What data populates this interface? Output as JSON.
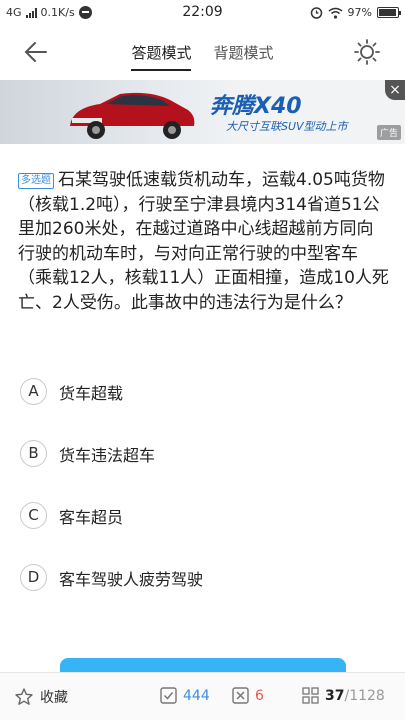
{
  "status_bar": {
    "network": "4G",
    "speed": "0.1K/s",
    "time": "22:09",
    "battery": "97%",
    "battery_level": 0.97
  },
  "nav": {
    "tabs": [
      {
        "label": "答题模式",
        "active": true
      },
      {
        "label": "背题模式",
        "active": false
      }
    ],
    "icons": {
      "back": "back-arrow-icon",
      "theme": "brightness-icon"
    }
  },
  "ad": {
    "brand": "奔腾X40",
    "slogan": "大尺寸互联SUV型动上市",
    "tag": "广告",
    "close": "×"
  },
  "question": {
    "type_badge": "多选题",
    "text": "石某驾驶低速载货机动车，运载4.05吨货物（核载1.2吨），行驶至宁津县境内314省道51公里加260米处，在越过道路中心线超越前方同向行驶的机动车时，与对向正常行驶的中型客车（乘载12人，核载11人）正面相撞，造成10人死亡、2人受伤。此事故中的违法行为是什么？"
  },
  "options": [
    {
      "letter": "A",
      "text": "货车超载"
    },
    {
      "letter": "B",
      "text": "货车违法超车"
    },
    {
      "letter": "C",
      "text": "客车超员"
    },
    {
      "letter": "D",
      "text": "客车驾驶人疲劳驾驶"
    }
  ],
  "bottom_bar": {
    "favorite_label": "收藏",
    "correct_count": "444",
    "wrong_count": "6",
    "current": "37",
    "total": "/1128"
  },
  "colors": {
    "accent": "#3b8fe0",
    "wrong": "#e8584f",
    "button": "#36b4f5"
  }
}
